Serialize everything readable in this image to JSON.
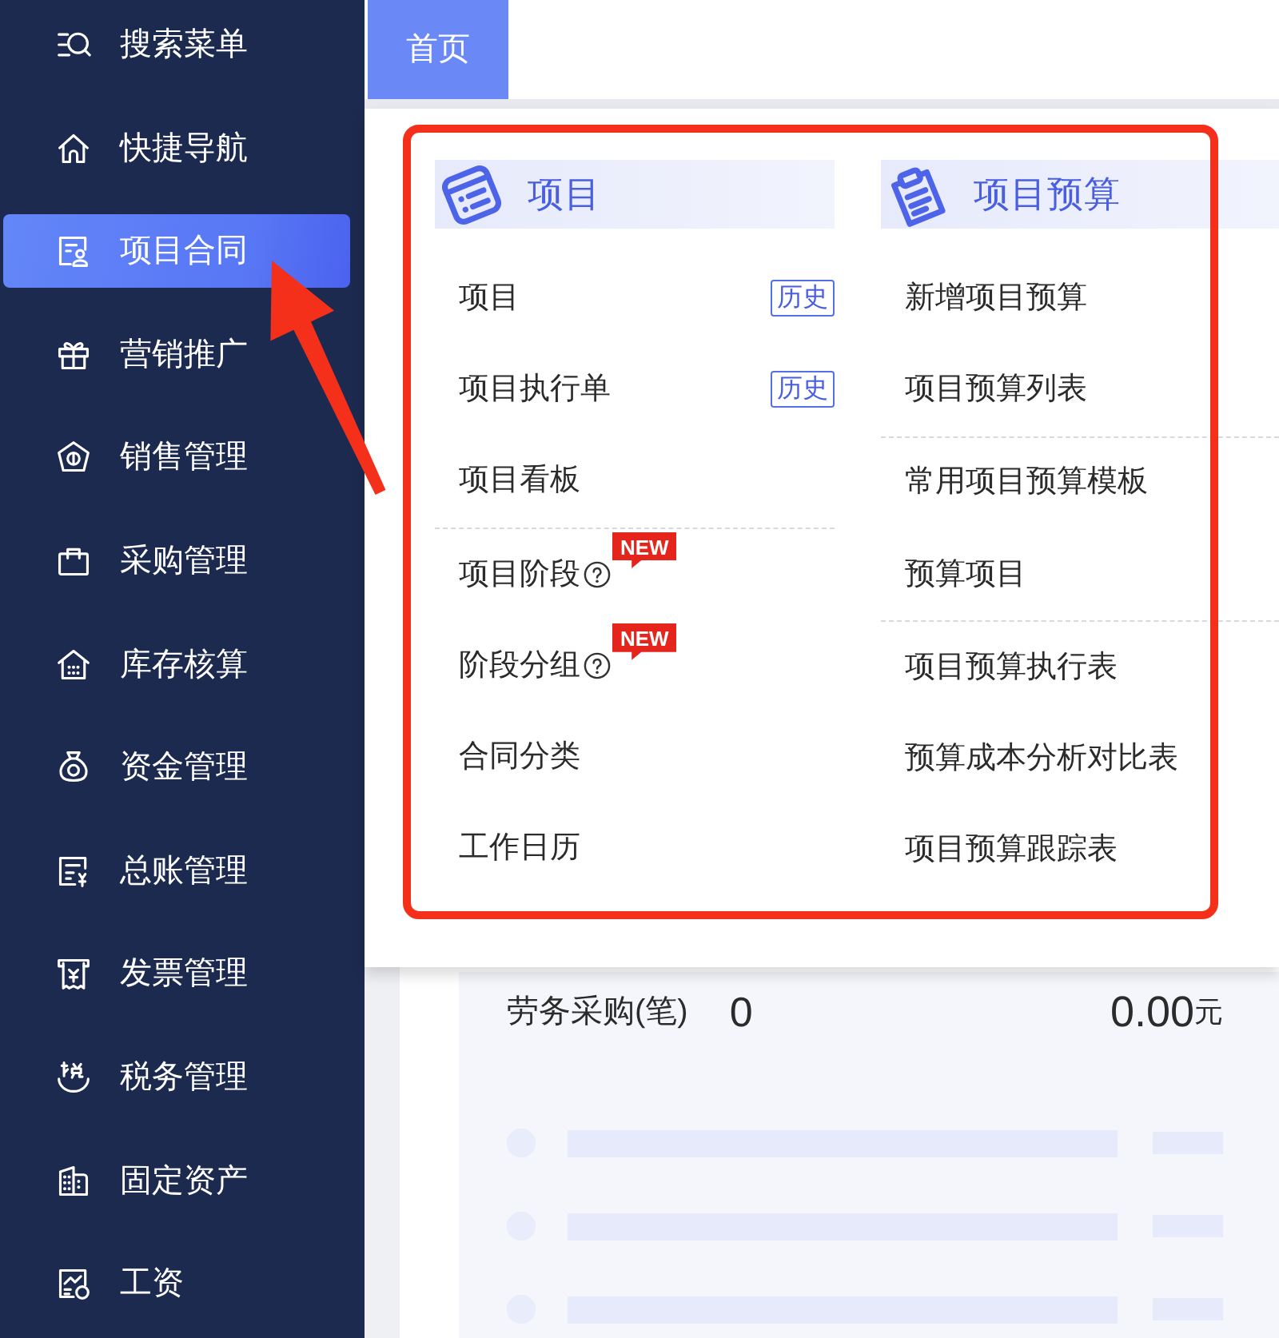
{
  "sidebar": {
    "items": [
      {
        "label": "搜索菜单",
        "selected": false
      },
      {
        "label": "快捷导航",
        "selected": false
      },
      {
        "label": "项目合同",
        "selected": true
      },
      {
        "label": "营销推广",
        "selected": false
      },
      {
        "label": "销售管理",
        "selected": false
      },
      {
        "label": "采购管理",
        "selected": false
      },
      {
        "label": "库存核算",
        "selected": false
      },
      {
        "label": "资金管理",
        "selected": false
      },
      {
        "label": "总账管理",
        "selected": false
      },
      {
        "label": "发票管理",
        "selected": false
      },
      {
        "label": "税务管理",
        "selected": false
      },
      {
        "label": "固定资产",
        "selected": false
      },
      {
        "label": "工资",
        "selected": false
      }
    ]
  },
  "tabs": [
    {
      "label": "首页",
      "selected": true
    }
  ],
  "dropdown": {
    "columns": [
      {
        "title": "项目",
        "groups": [
          {
            "items": [
              {
                "label": "项目",
                "help": false,
                "tag": "历史"
              },
              {
                "label": "项目执行单",
                "help": false,
                "tag": "历史"
              },
              {
                "label": "项目看板",
                "help": false
              }
            ]
          },
          {
            "items": [
              {
                "label": "项目阶段",
                "help": true,
                "badge": "NEW"
              },
              {
                "label": "阶段分组",
                "help": true,
                "badge": "NEW"
              },
              {
                "label": "合同分类",
                "help": false
              },
              {
                "label": "工作日历",
                "help": false
              }
            ]
          }
        ]
      },
      {
        "title": "项目预算",
        "groups": [
          {
            "items": [
              {
                "label": "新增项目预算",
                "help": false
              },
              {
                "label": "项目预算列表",
                "help": false
              }
            ]
          },
          {
            "items": [
              {
                "label": "常用项目预算模板",
                "help": false
              },
              {
                "label": "预算项目",
                "help": false
              }
            ]
          },
          {
            "items": [
              {
                "label": "项目预算执行表",
                "help": false
              },
              {
                "label": "预算成本分析对比表",
                "help": false
              },
              {
                "label": "项目预算跟踪表",
                "help": false
              }
            ]
          }
        ]
      }
    ]
  },
  "summary": {
    "label": "劳务采购(笔)",
    "count": "0",
    "amount": "0.00",
    "unit": "元"
  },
  "annotations": {
    "frame": true,
    "arrow": true
  }
}
